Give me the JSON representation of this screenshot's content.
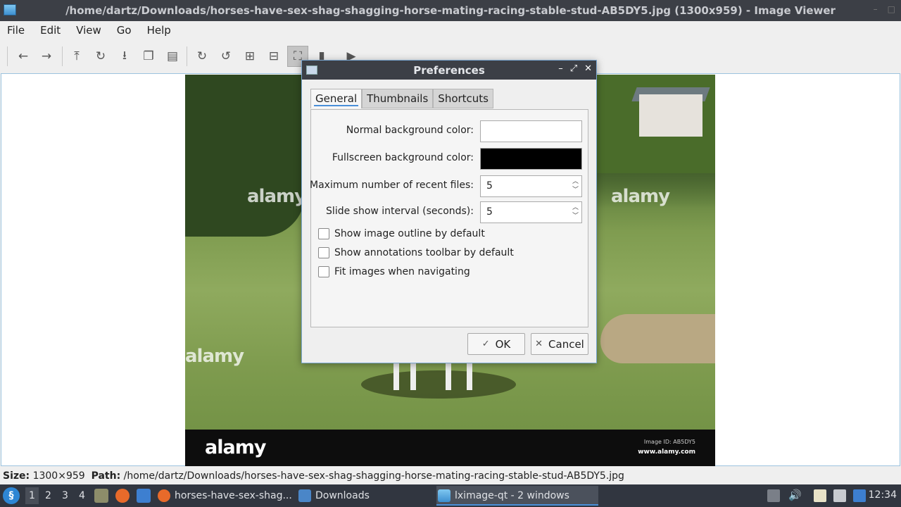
{
  "window": {
    "title": "/home/dartz/Downloads/horses-have-sex-shag-shagging-horse-mating-racing-stable-stud-AB5DY5.jpg (1300x959) - Image Viewer"
  },
  "menu": [
    "File",
    "Edit",
    "View",
    "Go",
    "Help"
  ],
  "photo": {
    "watermark": "alamy",
    "brand": "alamy",
    "image_id": "Image ID: AB5DY5",
    "url": "www.alamy.com"
  },
  "status": {
    "size_label": "Size:",
    "size_value": "1300×959",
    "path_label": "Path:",
    "path_value": "/home/dartz/Downloads/horses-have-sex-shag-shagging-horse-mating-racing-stable-stud-AB5DY5.jpg"
  },
  "dialog": {
    "title": "Preferences",
    "tabs": [
      "General",
      "Thumbnails",
      "Shortcuts"
    ],
    "normal_bg_label": "Normal background color:",
    "normal_bg_color": "#ffffff",
    "fullscreen_bg_label": "Fullscreen background color:",
    "fullscreen_bg_color": "#000000",
    "recent_files_label": "Maximum number of recent files:",
    "recent_files_value": "5",
    "slideshow_label": "Slide show interval (seconds):",
    "slideshow_value": "5",
    "checks": [
      {
        "label": "Show image outline by default",
        "checked": false
      },
      {
        "label": "Show annotations toolbar by default",
        "checked": false
      },
      {
        "label": "Fit images when navigating",
        "checked": false
      }
    ],
    "ok_label": "OK",
    "cancel_label": "Cancel"
  },
  "taskbar": {
    "desktops": [
      "1",
      "2",
      "3",
      "4"
    ],
    "tasks": [
      {
        "label": "horses-have-sex-shag..."
      },
      {
        "label": "Downloads"
      },
      {
        "label": "lximage-qt - 2 windows"
      }
    ],
    "clock": "12:34"
  },
  "colors": {
    "accent": "#4a90d9",
    "titlebar": "#3c3f46",
    "taskbar": "#313640"
  }
}
